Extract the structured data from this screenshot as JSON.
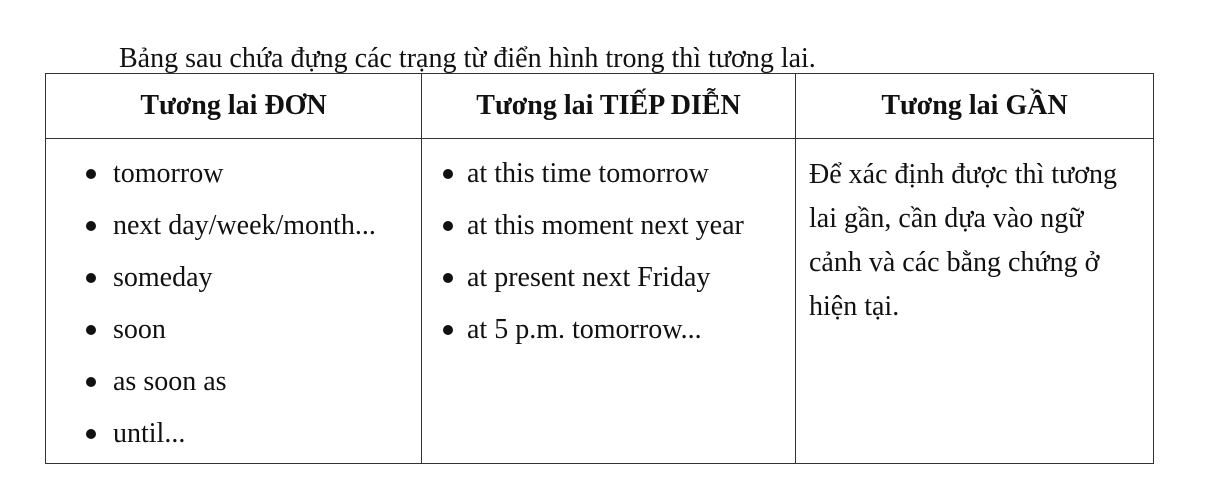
{
  "intro": "Bảng sau chứa đựng các trạng từ điển hình trong thì tương lai.",
  "table": {
    "headers": [
      "Tương lai ĐƠN",
      "Tương lai TIẾP DIỄN",
      "Tương lai GẦN"
    ],
    "simple_future": [
      "tomorrow",
      "next day/week/month...",
      "someday",
      "soon",
      "as soon as",
      "until..."
    ],
    "future_continuous": [
      "at this time tomorrow",
      "at this moment next year",
      "at present next Friday",
      "at 5 p.m. tomorrow..."
    ],
    "near_future_note": "Để xác định được thì tương lai gần, cần dựa vào ngữ cảnh và các bằng chứng ở hiện tại."
  }
}
